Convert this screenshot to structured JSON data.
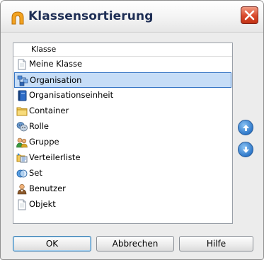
{
  "dialog": {
    "title": "Klassensortierung"
  },
  "list": {
    "header": "Klasse",
    "selected_index": 1,
    "items": [
      {
        "label": "Meine Klasse",
        "icon": "document-icon"
      },
      {
        "label": "Organisation",
        "icon": "organisation-icon"
      },
      {
        "label": "Organisationseinheit",
        "icon": "book-icon"
      },
      {
        "label": "Container",
        "icon": "folder-icon"
      },
      {
        "label": "Rolle",
        "icon": "role-icon"
      },
      {
        "label": "Gruppe",
        "icon": "group-icon"
      },
      {
        "label": "Verteilerliste",
        "icon": "distribution-list-icon"
      },
      {
        "label": "Set",
        "icon": "set-icon"
      },
      {
        "label": "Benutzer",
        "icon": "user-icon"
      },
      {
        "label": "Objekt",
        "icon": "document-icon"
      }
    ]
  },
  "buttons": {
    "ok": "OK",
    "cancel": "Abbrechen",
    "help": "Hilfe"
  },
  "colors": {
    "selection_fill": "#c6ddf7",
    "selection_border": "#3a78c6",
    "title_text": "#1e2e55",
    "close_red": "#d9472a",
    "arrow_blue": "#2f78c9"
  }
}
